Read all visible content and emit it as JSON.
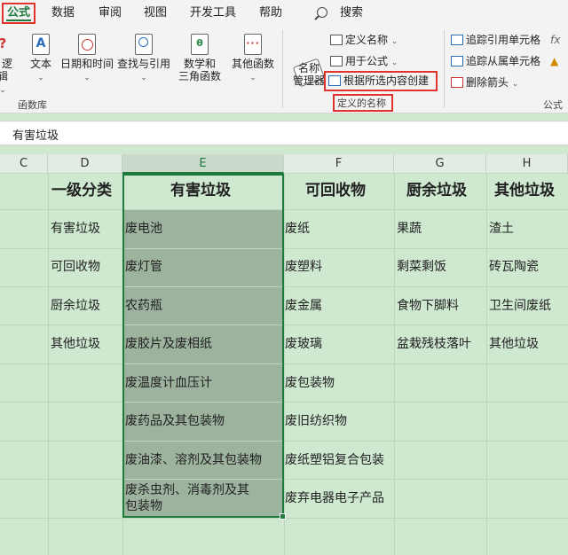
{
  "tabs": [
    "公式",
    "数据",
    "审阅",
    "视图",
    "开发工具",
    "帮助"
  ],
  "search_label": "搜索",
  "ribbon": {
    "function_library": {
      "label": "函数库",
      "buttons": [
        {
          "label": "逻辑",
          "icon": "question-icon"
        },
        {
          "label": "文本",
          "icon": "text-a-icon"
        },
        {
          "label": "日期和时间",
          "icon": "clock-icon"
        },
        {
          "label": "查找与引用",
          "icon": "magnifier-icon"
        },
        {
          "label": "数学和\n三角函数",
          "icon": "theta-icon"
        },
        {
          "label": "其他函数",
          "icon": "more-icon"
        }
      ]
    },
    "defined_names": {
      "label": "定义的名称",
      "name_manager": "名称\n管理器",
      "define_name": "定义名称",
      "use_in_formula": "用于公式",
      "create_from_selection": "根据所选内容创建"
    },
    "formula_auditing": {
      "label": "公式",
      "trace_precedents": "追踪引用单元格",
      "trace_dependents": "追踪从属单元格",
      "remove_arrows": "删除箭头"
    }
  },
  "formula_bar": {
    "value": "有害垃圾"
  },
  "columns": [
    "C",
    "D",
    "E",
    "F",
    "G",
    "H"
  ],
  "selected_column": "E",
  "sheet": {
    "headers": [
      "一级分类",
      "有害垃圾",
      "可回收物",
      "厨余垃圾",
      "其他垃圾"
    ],
    "col_d": [
      "有害垃圾",
      "可回收物",
      "厨余垃圾",
      "其他垃圾"
    ],
    "col_e": [
      "废电池",
      "废灯管",
      "农药瓶",
      "废胶片及废相纸",
      "废温度计血压计",
      "废药品及其包装物",
      "废油漆、溶剂及其包装物",
      "废杀虫剂、消毒剂及其\n包装物"
    ],
    "col_f": [
      "废纸",
      "废塑料",
      "废金属",
      "废玻璃",
      "废包装物",
      "废旧纺织物",
      "废纸塑铝复合包装",
      "废弃电器电子产品"
    ],
    "col_g": [
      "果蔬",
      "剩菜剩饭",
      "食物下脚料",
      "盆栽残枝落叶"
    ],
    "col_h": [
      "渣土",
      "砖瓦陶瓷",
      "卫生间废纸",
      "其他垃圾"
    ]
  }
}
